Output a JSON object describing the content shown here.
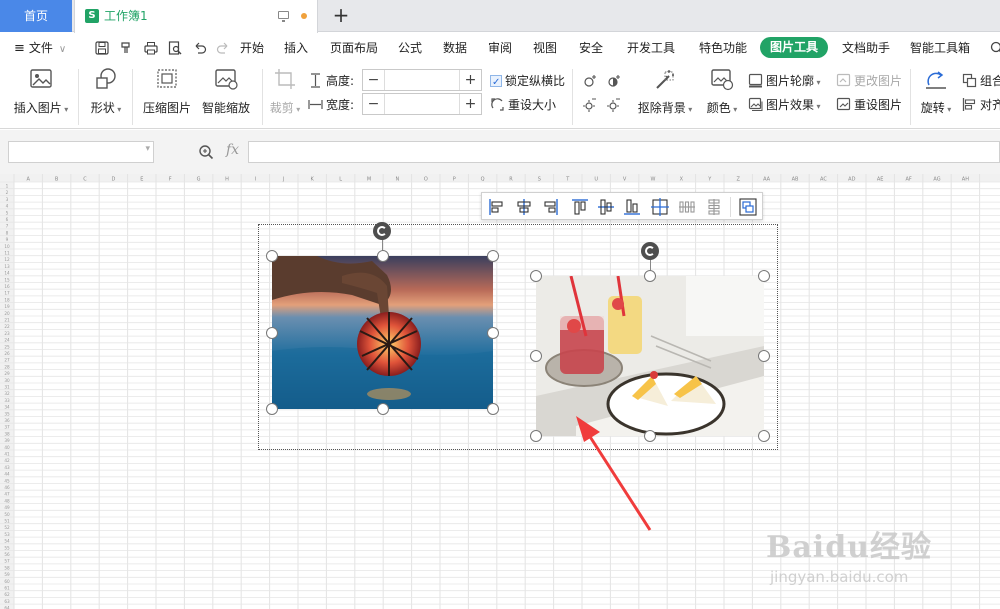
{
  "tabs": {
    "home": "首页",
    "doc_title": "工作簿1",
    "doc_icon_letter": "S"
  },
  "menu": {
    "file": "文件",
    "items": [
      "开始",
      "插入",
      "页面布局",
      "公式",
      "数据",
      "审阅",
      "视图",
      "安全",
      "开发工具",
      "特色功能"
    ],
    "active": "图片工具",
    "after": [
      "文档助手",
      "智能工具箱"
    ]
  },
  "ribbon": {
    "insert_picture": "插入图片",
    "shape": "形状",
    "compress": "压缩图片",
    "smart_zoom": "智能缩放",
    "crop": "裁剪",
    "height_label": "高度:",
    "width_label": "宽度:",
    "minus": "−",
    "plus": "+",
    "lock_ratio": "锁定纵横比",
    "reset_size": "重设大小",
    "remove_bg": "抠除背景",
    "color": "颜色",
    "outline": "图片轮廓",
    "effects": "图片效果",
    "change_picture": "更改图片",
    "reset_picture": "重设图片",
    "rotate": "旋转",
    "combine": "组合",
    "align": "对齐"
  },
  "formula_bar": {
    "fx": "fx"
  },
  "sheet": {
    "columns": [
      "A",
      "B",
      "C",
      "D",
      "E",
      "F",
      "G",
      "H",
      "I",
      "J",
      "K",
      "L",
      "M",
      "N",
      "O",
      "P",
      "Q",
      "R",
      "S",
      "T",
      "U",
      "V",
      "W",
      "X",
      "Y",
      "Z",
      "AA",
      "AB",
      "AC",
      "AD",
      "AE",
      "AF",
      "AG",
      "AH"
    ]
  },
  "watermark": {
    "brand": "Baidu经验",
    "url": "jingyan.baidu.com"
  },
  "colors": {
    "accent_green": "#21a366",
    "home_tab_blue": "#4a88e8",
    "annotation_arrow": "#f03c3c"
  }
}
